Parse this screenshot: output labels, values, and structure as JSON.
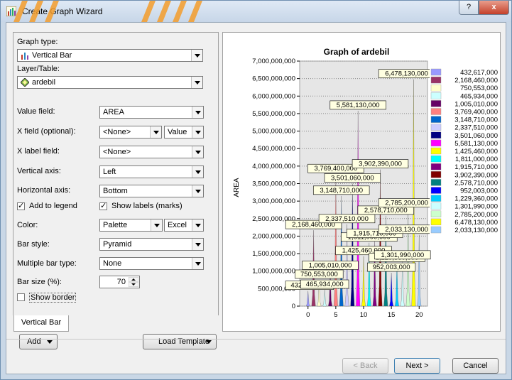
{
  "window": {
    "title": "Create Graph Wizard",
    "help_glyph": "?",
    "close_glyph": "x"
  },
  "form": {
    "graph_type_label": "Graph type:",
    "graph_type_value": "Vertical Bar",
    "layer_label": "Layer/Table:",
    "layer_value": "ardebil",
    "value_field_label": "Value field:",
    "value_field_value": "AREA",
    "x_field_label": "X field (optional):",
    "x_field_value": "<None>",
    "x_field_sort": "Value",
    "x_label_field_label": "X label field:",
    "x_label_field_value": "<None>",
    "vertical_axis_label": "Vertical axis:",
    "vertical_axis_value": "Left",
    "horizontal_axis_label": "Horizontal axis:",
    "horizontal_axis_value": "Bottom",
    "add_to_legend_label": "Add to legend",
    "add_to_legend_checked": true,
    "show_labels_label": "Show labels (marks)",
    "show_labels_checked": true,
    "color_label": "Color:",
    "color_value": "Palette",
    "color_scheme": "Excel",
    "bar_style_label": "Bar style:",
    "bar_style_value": "Pyramid",
    "multiple_bar_label": "Multiple bar type:",
    "multiple_bar_value": "None",
    "bar_size_label": "Bar size (%):",
    "bar_size_value": "70",
    "show_border_label": "Show border",
    "show_border_checked": false
  },
  "tabs": {
    "active": "Vertical Bar"
  },
  "buttons": {
    "add": "Add",
    "load_template": "Load Template",
    "back": "< Back",
    "next": "Next >",
    "cancel": "Cancel"
  },
  "chart_data": {
    "type": "bar",
    "title": "Graph of ardebil",
    "ylabel": "AREA",
    "xlabel": "",
    "x": [
      1,
      2,
      3,
      4,
      5,
      6,
      7,
      8,
      9,
      10,
      11,
      12,
      13,
      14,
      15,
      16,
      17,
      18,
      19,
      20
    ],
    "values": [
      432617000,
      2168460000,
      750553000,
      465934000,
      1005010000,
      3769400000,
      3148710000,
      2337510000,
      3501060000,
      5581130000,
      1425460000,
      1811000000,
      1915710000,
      3902390000,
      2578710000,
      952003000,
      1229360000,
      1301990000,
      2785200000,
      6478130000,
      2033130000
    ],
    "ylim": [
      0,
      7000000000
    ],
    "yticks": [
      "0",
      "500,000,000",
      "1,000,000,000",
      "1,500,000,000",
      "2,000,000,000",
      "2,500,000,000",
      "3,000,000,000",
      "3,500,000,000",
      "4,000,000,000",
      "4,500,000,000",
      "5,000,000,000",
      "5,500,000,000",
      "6,000,000,000",
      "6,500,000,000",
      "7,000,000,000"
    ],
    "xlim": [
      -1.5,
      21.5
    ],
    "xticks": [
      "0",
      "5",
      "10",
      "15",
      "20"
    ],
    "data_labels": [
      "432,617,000",
      "2,168,460,000",
      "750,553,000",
      "465,934,000",
      "1,005,010,000",
      "3,769,400,000",
      "3,148,710,000",
      "2,337,510,000",
      "3,501,060,000",
      "5,581,130,000",
      "1,425,460,000",
      "1,811,000,000",
      "1,915,710,000",
      "3,902,390,000",
      "2,578,710,000",
      "952,003,000",
      "1,229,360,000",
      "1,301,990,000",
      "2,785,200,000",
      "6,478,130,000",
      "2,033,130,000"
    ],
    "legend": [
      "432,617,000",
      "2,168,460,000",
      "750,553,000",
      "465,934,000",
      "1,005,010,000",
      "3,769,400,000",
      "3,148,710,000",
      "2,337,510,000",
      "3,501,060,000",
      "5,581,130,000",
      "1,425,460,000",
      "1,811,000,000",
      "1,915,710,000",
      "3,902,390,000",
      "2,578,710,000",
      "952,003,000",
      "1,229,360,000",
      "1,301,990,000",
      "2,785,200,000",
      "6,478,130,000",
      "2,033,130,000"
    ],
    "colors": [
      "#9999ff",
      "#993366",
      "#ffffcc",
      "#ccffff",
      "#660066",
      "#ff8080",
      "#0066cc",
      "#ccccff",
      "#000080",
      "#ff00ff",
      "#ffff00",
      "#00ffff",
      "#800080",
      "#800000",
      "#008080",
      "#0000ff",
      "#00ccff",
      "#ccffff",
      "#ccffcc",
      "#ffff00",
      "#99ccff"
    ],
    "legend_position": "right",
    "grid": true
  }
}
